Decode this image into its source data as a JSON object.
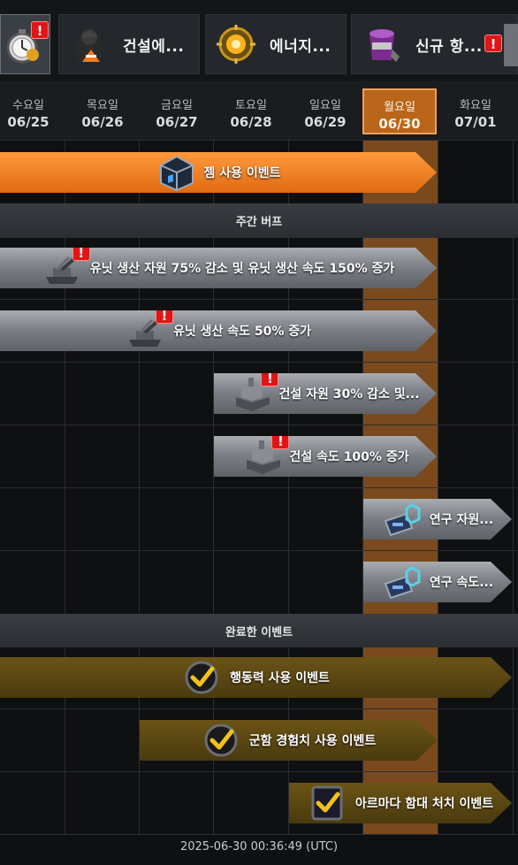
{
  "tabs": [
    {
      "label": "",
      "icon": "stopwatch-icon",
      "alert": "!"
    },
    {
      "label": "건설에...",
      "icon": "construction-worker-icon"
    },
    {
      "label": "에너지...",
      "icon": "energy-core-icon"
    },
    {
      "label": "신규 항...",
      "icon": "paint-bucket-icon",
      "alert": "!"
    }
  ],
  "days": [
    {
      "name": "수요일",
      "date": "06/25"
    },
    {
      "name": "목요일",
      "date": "06/26"
    },
    {
      "name": "금요일",
      "date": "06/27"
    },
    {
      "name": "토요일",
      "date": "06/28"
    },
    {
      "name": "일요일",
      "date": "06/29"
    },
    {
      "name": "월요일",
      "date": "06/30"
    },
    {
      "name": "화요일",
      "date": "07/01"
    }
  ],
  "today": "06/30",
  "events": {
    "gem": {
      "label": "젬 사용 이벤트",
      "icon": "gem-crate-icon"
    }
  },
  "sections": {
    "weekly_buff": "주간 버프",
    "completed": "완료한 이벤트"
  },
  "buffs": [
    {
      "label": "유닛 생산 자원 75% 감소 및 유닛 생산 속도 150% 증가",
      "icon": "artillery-unit-icon",
      "alert": "!"
    },
    {
      "label": "유닛 생산 속도 50% 증가",
      "icon": "artillery-unit-icon",
      "alert": "!"
    },
    {
      "label": "건설 자원 30% 감소 및...",
      "icon": "building-icon",
      "alert": "!"
    },
    {
      "label": "건설 속도 100% 증가",
      "icon": "building-icon",
      "alert": "!"
    },
    {
      "label": "연구 자원...",
      "icon": "research-chip-icon"
    },
    {
      "label": "연구 속도...",
      "icon": "research-chip-icon"
    }
  ],
  "completed": [
    {
      "label": "행동력 사용 이벤트",
      "icon": "check-badge-icon"
    },
    {
      "label": "군함 경험치 사용 이벤트",
      "icon": "check-badge-icon"
    },
    {
      "label": "아르마다 함대 처치 이벤트",
      "icon": "check-badge-icon"
    }
  ],
  "colors": {
    "today_column": "#7a4a1e",
    "event_active": "#f07a1e",
    "buff_bar": "#8a8e94",
    "completed_bar": "#5a4612",
    "alert_red": "#e01515",
    "check_gold": "#f2c21b"
  },
  "footer": {
    "timestamp": "2025-06-30 00:36:49 (UTC)"
  }
}
